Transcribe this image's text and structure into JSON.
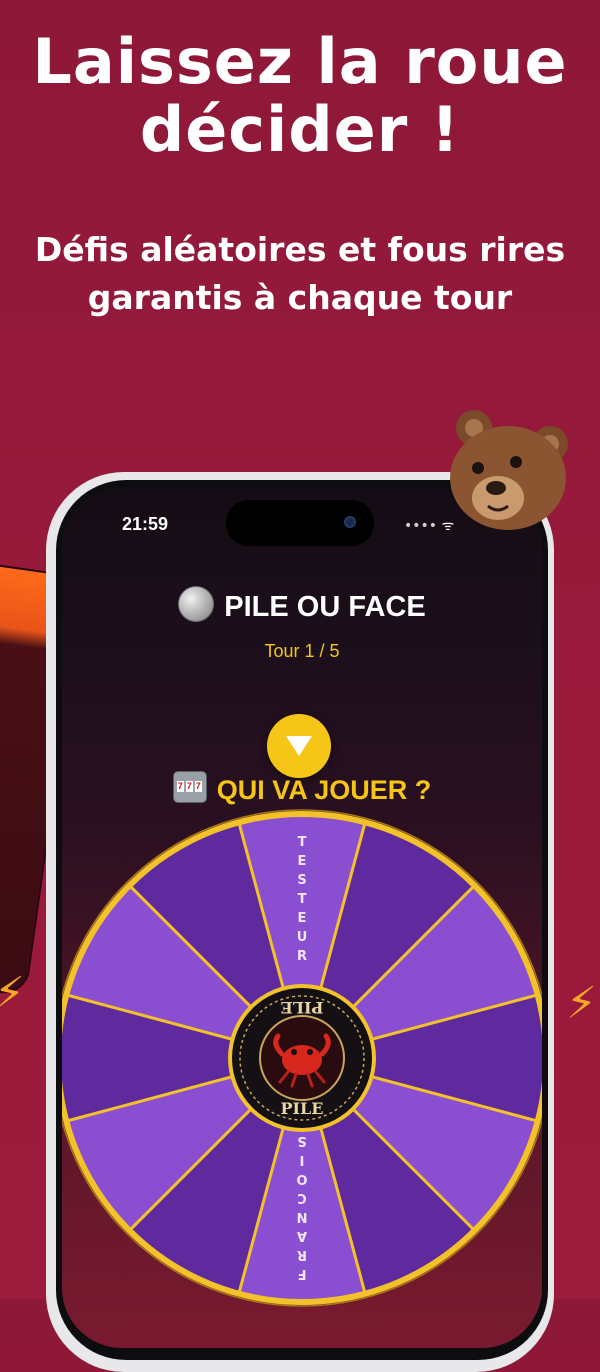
{
  "promo": {
    "headline_line1": "Laissez la roue",
    "headline_line2": "décider !",
    "subline_line1": "Défis aléatoires et fous rires",
    "subline_line2": "garantis à chaque tour"
  },
  "status_bar": {
    "time": "21:59"
  },
  "game": {
    "icon": "coin-icon",
    "title": "PILE OU FACE",
    "round": "Tour 1 / 5",
    "question": "QUI VA JOUER ?",
    "question_icon": "slot-machine-icon"
  },
  "wheel": {
    "segment_count": 12,
    "labels": [
      "TESTEUR",
      "FRANCOIS"
    ],
    "hub_text": "PILE",
    "hub_icon": "crab-icon",
    "colors": {
      "dark": "#5e2a9e",
      "light": "#8a4fd0",
      "rim": "#f3c22a",
      "hub": "#141014"
    }
  },
  "colors": {
    "background": "#9a1a3c",
    "accent": "#f5c518"
  },
  "decor": {
    "bear": "bear-emoji-icon",
    "bolt": "lightning-icon"
  }
}
